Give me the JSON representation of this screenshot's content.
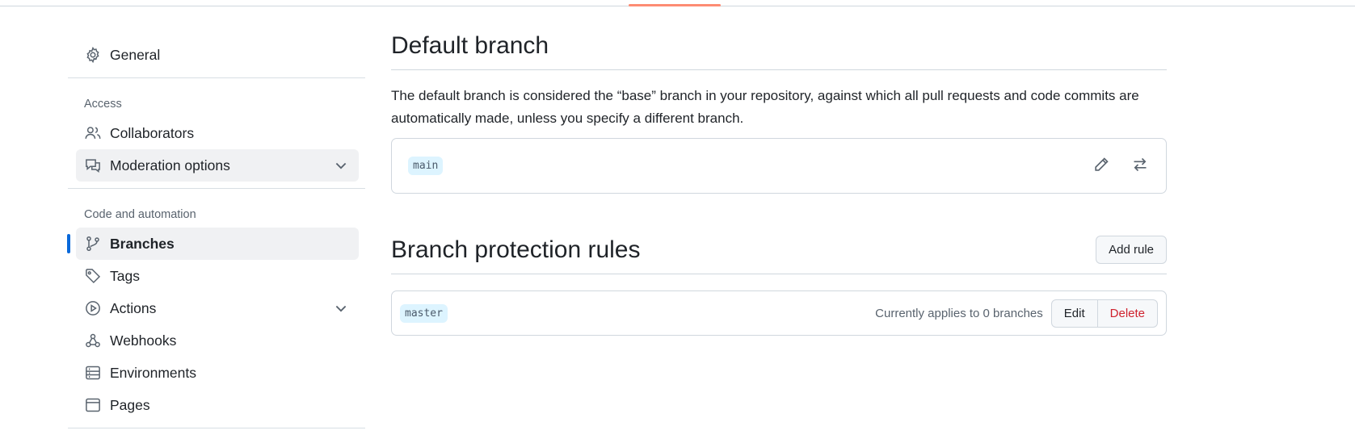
{
  "sidebar": {
    "general": "General",
    "access_title": "Access",
    "access_items": [
      {
        "label": "Collaborators",
        "icon": "people-icon"
      },
      {
        "label": "Moderation options",
        "icon": "moderation-icon"
      }
    ],
    "code_title": "Code and automation",
    "code_items": [
      {
        "label": "Branches",
        "icon": "git-branch-icon"
      },
      {
        "label": "Tags",
        "icon": "tag-icon"
      },
      {
        "label": "Actions",
        "icon": "play-icon"
      },
      {
        "label": "Webhooks",
        "icon": "webhook-icon"
      },
      {
        "label": "Environments",
        "icon": "server-icon"
      },
      {
        "label": "Pages",
        "icon": "browser-icon"
      }
    ]
  },
  "default_branch": {
    "title": "Default branch",
    "description": "The default branch is considered the “base” branch in your repository, against which all pull requests and code commits are automatically made, unless you specify a different branch.",
    "branch_name": "main"
  },
  "protection": {
    "title": "Branch protection rules",
    "add_rule_label": "Add rule",
    "rules": [
      {
        "pattern": "master",
        "applies_text": "Currently applies to 0 branches",
        "edit_label": "Edit",
        "delete_label": "Delete"
      }
    ]
  },
  "colors": {
    "accent": "#0969da",
    "danger": "#cf222e",
    "tab_underline": "#fd8c73"
  }
}
